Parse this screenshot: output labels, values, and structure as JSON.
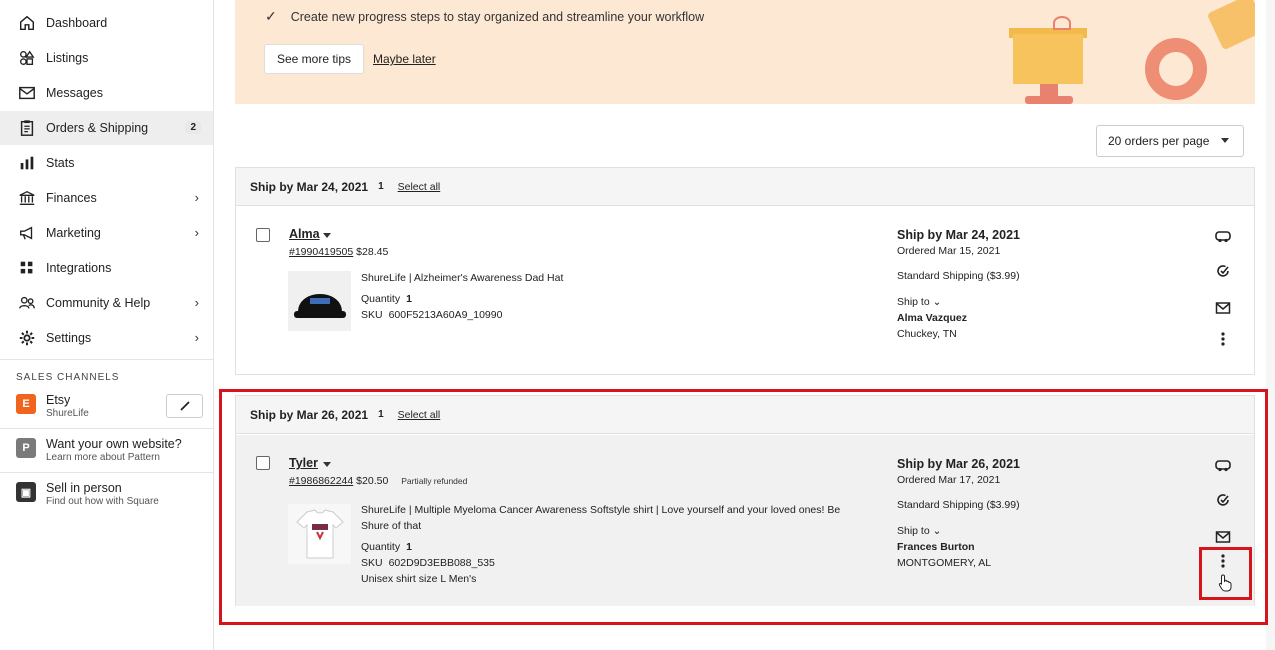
{
  "sidebar": {
    "items": [
      {
        "label": "Dashboard",
        "icon": "home-icon"
      },
      {
        "label": "Listings",
        "icon": "shapes-icon"
      },
      {
        "label": "Messages",
        "icon": "mail-icon"
      },
      {
        "label": "Orders & Shipping",
        "icon": "clipboard-icon",
        "badge": "2"
      },
      {
        "label": "Stats",
        "icon": "bar-chart-icon"
      },
      {
        "label": "Finances",
        "icon": "bank-icon"
      },
      {
        "label": "Marketing",
        "icon": "megaphone-icon"
      },
      {
        "label": "Integrations",
        "icon": "grid-icon"
      },
      {
        "label": "Community & Help",
        "icon": "people-icon"
      },
      {
        "label": "Settings",
        "icon": "gear-icon"
      }
    ],
    "section_label": "SALES CHANNELS",
    "channels": [
      {
        "title": "Etsy",
        "sub": "ShureLife",
        "logo": "E",
        "color": "#f1641e"
      },
      {
        "title": "Want your own website?",
        "sub": "Learn more about Pattern",
        "logo": "P",
        "color": "#7a7a7a"
      },
      {
        "title": "Sell in person",
        "sub": "Find out how with Square",
        "logo": "▣",
        "color": "#333333"
      }
    ]
  },
  "banner": {
    "tip": "Create new progress steps to stay organized and streamline your workflow",
    "see_more": "See more tips",
    "maybe_later": "Maybe later"
  },
  "per_page": "20 orders per page",
  "groups": [
    {
      "title": "Ship by Mar 24, 2021",
      "count": "1",
      "select_all": "Select all",
      "order": {
        "buyer": "Alma",
        "order_id": "#1990419505",
        "price": "$28.45",
        "tag": "",
        "product": "ShureLife | Alzheimer's Awareness Dad Hat",
        "quantity_label": "Quantity",
        "quantity": "1",
        "sku_label": "SKU",
        "sku": "600F5213A60A9_10990",
        "variation": "",
        "ship_by": "Ship by Mar 24, 2021",
        "ordered": "Ordered Mar 15, 2021",
        "shipping": "Standard Shipping  ($3.99)",
        "ship_to": "Ship to ⌄",
        "recipient": "Alma Vazquez",
        "location": "Chuckey, TN"
      }
    },
    {
      "title": "Ship by Mar 26, 2021",
      "count": "1",
      "select_all": "Select all",
      "order": {
        "buyer": "Tyler",
        "order_id": "#1986862244",
        "price": "$20.50",
        "tag": "Partially refunded",
        "product": "ShureLife | Multiple Myeloma Cancer Awareness Softstyle shirt | Love yourself and your loved ones! Be Shure of that",
        "quantity_label": "Quantity",
        "quantity": "1",
        "sku_label": "SKU",
        "sku": "602D9D3EBB088_535",
        "variation": "Unisex shirt size  L Men's",
        "ship_by": "Ship by Mar 26, 2021",
        "ordered": "Ordered Mar 17, 2021",
        "shipping": "Standard Shipping  ($3.99)",
        "ship_to": "Ship to ⌄",
        "recipient": "Frances Burton",
        "location": "MONTGOMERY, AL"
      }
    }
  ],
  "colors": {
    "highlight": "#d6141b",
    "banner": "#fde8d4",
    "etsy": "#f1641e"
  }
}
